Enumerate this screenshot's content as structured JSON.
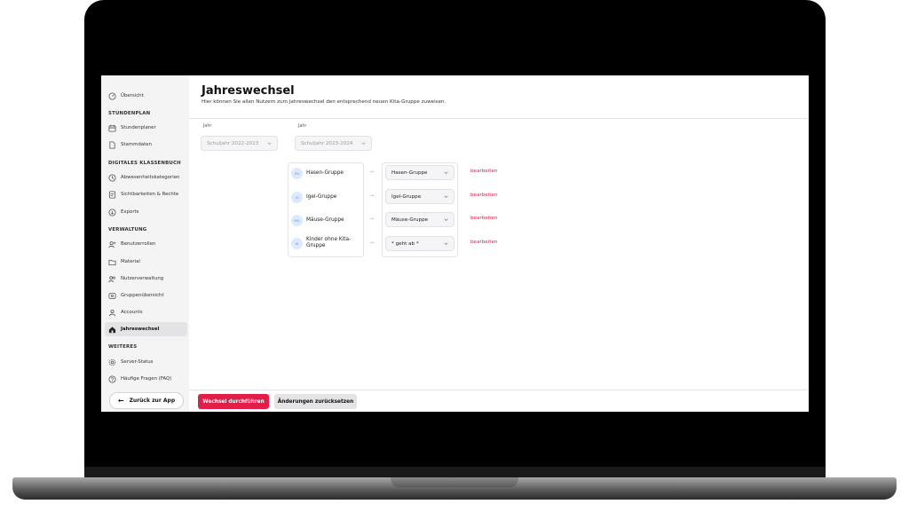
{
  "sidebar": {
    "items": [
      {
        "label": "Übersicht",
        "icon": "dashboard-icon"
      },
      {
        "section": "STUNDENPLAN"
      },
      {
        "label": "Stundenplaner",
        "icon": "calendar-icon"
      },
      {
        "label": "Stammdaten",
        "icon": "document-icon"
      },
      {
        "section": "DIGITALES KLASSENBUCH"
      },
      {
        "label": "Abwesenheitskategorien",
        "icon": "clock-icon"
      },
      {
        "label": "Sichtbarkeiten & Rechte",
        "icon": "eye-doc-icon"
      },
      {
        "label": "Exports",
        "icon": "export-icon"
      },
      {
        "section": "VERWALTUNG"
      },
      {
        "label": "Benutzerrollen",
        "icon": "users-icon"
      },
      {
        "label": "Material",
        "icon": "folder-icon"
      },
      {
        "label": "Nutzerverwaltung",
        "icon": "user-group-icon"
      },
      {
        "label": "Gruppenübersicht",
        "icon": "group-icon"
      },
      {
        "label": "Accounts",
        "icon": "person-icon"
      },
      {
        "label": "Jahreswechsel",
        "icon": "home-icon",
        "active": true
      },
      {
        "section": "WEITERES"
      },
      {
        "label": "Server-Status",
        "icon": "gear-icon"
      },
      {
        "label": "Häufige Fragen (FAQ)",
        "icon": "help-icon"
      }
    ],
    "back_label": "Zurück zur App"
  },
  "header": {
    "title": "Jahreswechsel",
    "subtitle": "Hier können Sie allen Nutzern zum Jahreswechsel den entsprechend neuen Kita-Gruppe zuweisen."
  },
  "year_from": {
    "label": "Jahr",
    "value": "Schuljahr 2022-2023"
  },
  "year_to": {
    "label": "Jahr",
    "value": "Schuljahr 2023-2024"
  },
  "groups": [
    {
      "badge": "HG",
      "name": "Hasen-Gruppe",
      "target": "Hasen-Gruppe",
      "action": "bearbeiten"
    },
    {
      "badge": "IG",
      "name": "Igel-Gruppe",
      "target": "Igel-Gruppe",
      "action": "bearbeiten"
    },
    {
      "badge": "MG",
      "name": "Mäuse-Gruppe",
      "target": "Mäuse-Gruppe",
      "action": "bearbeiten"
    },
    {
      "badge": "KI",
      "name": "Kinder ohne Kita-Gruppe",
      "target": "* geht ab *",
      "action": "bearbeiten"
    }
  ],
  "footer": {
    "primary": "Wechsel durchführen",
    "secondary": "Änderungen zurücksetzen"
  },
  "colors": {
    "accent": "#e11d48",
    "sidebar_bg": "#f4f4f5"
  }
}
